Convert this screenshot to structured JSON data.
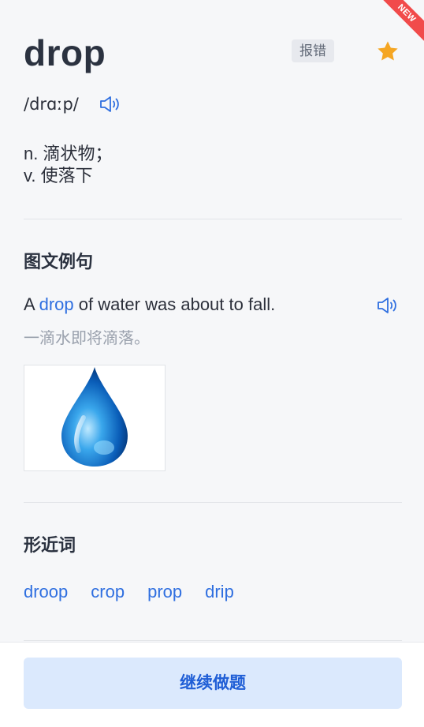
{
  "badge": {
    "new_label": "NEW"
  },
  "word": {
    "title": "drop",
    "phonetic": "/drɑːp/",
    "definitions": [
      "n. 滴状物；",
      "v. 使落下"
    ]
  },
  "actions": {
    "report_label": "报错"
  },
  "example_section": {
    "title": "图文例句",
    "sentence_before": "A ",
    "sentence_highlight": "drop",
    "sentence_after": " of water was about to fall.",
    "translation": "一滴水即将滴落。"
  },
  "similar_section": {
    "title": "形近词",
    "words": [
      "droop",
      "crop",
      "prop",
      "drip"
    ]
  },
  "footer": {
    "continue_label": "继续做题"
  },
  "colors": {
    "accent": "#2f6fe0",
    "star": "#f5a623",
    "new_ribbon": "#f14b4b",
    "button_bg": "#dbe9fd"
  },
  "icons": [
    "star-icon",
    "speaker-icon",
    "water-drop-image"
  ]
}
